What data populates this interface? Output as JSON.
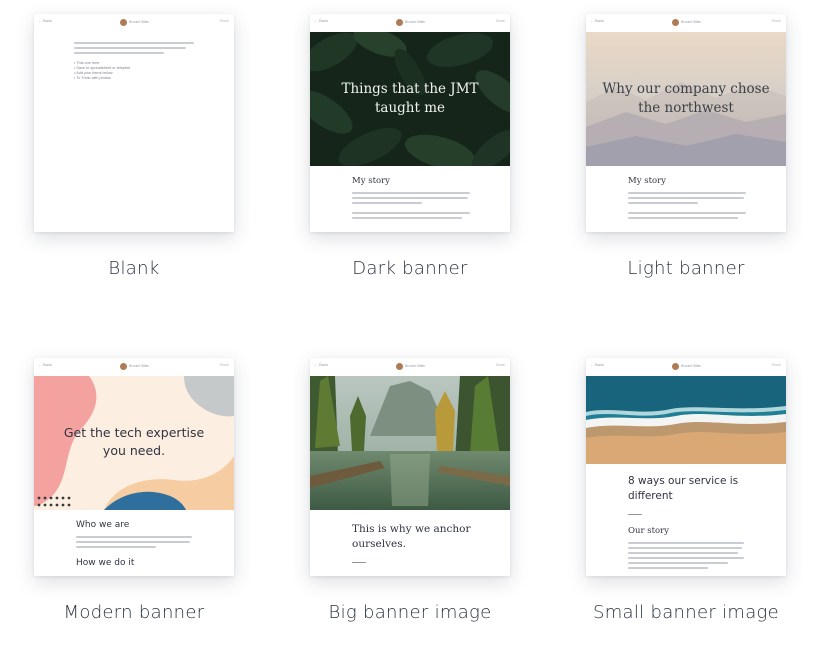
{
  "templates": [
    {
      "caption": "Blank",
      "header": {
        "back": "← Back",
        "author": "Brooke Miller",
        "menu": "Share"
      },
      "bullets": [
        "• This one here",
        "• Save to spreadsheet or teleprint",
        "• Add your items below",
        "• To Trello with photos"
      ]
    },
    {
      "caption": "Dark banner",
      "header": {
        "back": "← Back",
        "author": "Brooke Miller",
        "menu": "Share"
      },
      "banner_title": "Things that the JMT taught me",
      "section_title": "My story"
    },
    {
      "caption": "Light banner",
      "header": {
        "back": "← Back",
        "author": "Brooke Miller",
        "menu": "Share"
      },
      "banner_title": "Why our company chose the northwest",
      "section_title": "My story"
    },
    {
      "caption": "Modern banner",
      "header": {
        "back": "← Back",
        "author": "Brooke Miller",
        "menu": "Share"
      },
      "banner_title": "Get the tech expertise you need.",
      "section_title": "Who we are",
      "section_title_2": "How we do it"
    },
    {
      "caption": "Big banner image",
      "header": {
        "back": "← Back",
        "author": "Brooke Miller",
        "menu": "Share"
      },
      "section_title": "This is why we anchor ourselves."
    },
    {
      "caption": "Small banner image",
      "header": {
        "back": "← Back",
        "author": "Brooke Miller",
        "menu": "Share"
      },
      "headline": "8 ways our service is different",
      "section_title": "Our story"
    }
  ],
  "colors": {
    "dark_banner": "#1f3326",
    "light_banner_top": "#e9d8c7",
    "light_banner_bottom": "#a9a8b4",
    "modern_bg": "#fdeee2",
    "modern_pink": "#f4a2a0",
    "modern_peach": "#f6cda3",
    "modern_blue": "#2f6f9e",
    "modern_grey": "#c5c9ca",
    "ocean": "#1f7f96",
    "sand": "#d9a875"
  }
}
